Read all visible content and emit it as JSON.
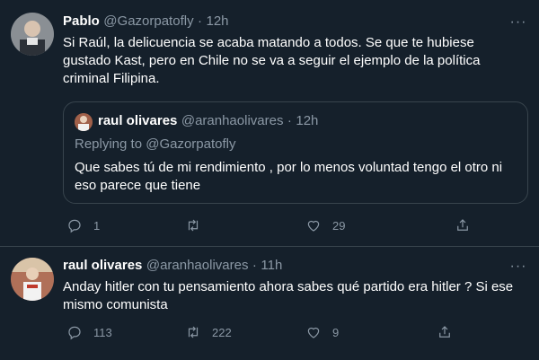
{
  "tweet1": {
    "name": "Pablo",
    "handle": "@Gazorpatofly",
    "separator": "·",
    "time": "12h",
    "text_line1": "Si Raúl, la delicuencia se acaba matando a todos. Se que te hubiese",
    "text_line2": "gustado Kast, pero en Chile no se va a seguir el ejemplo de la política",
    "text_line3": "criminal Filipina.",
    "quote": {
      "name": "raul olivares",
      "handle": "@aranhaolivares",
      "separator": "·",
      "time": "12h",
      "replying_to": "Replying to @Gazorpatofly",
      "text_line1": "Que sabes tú de mi rendimiento , por lo menos voluntad tengo el otro ni",
      "text_line2": "eso parece que tiene"
    },
    "actions": {
      "reply_count": "1",
      "retweet_count": "",
      "like_count": "29"
    }
  },
  "tweet2": {
    "name": "raul olivares",
    "handle": "@aranhaolivares",
    "separator": "·",
    "time": "11h",
    "text_line1": "Anday hitler con tu pensamiento ahora sabes qué partido era hitler ? Si ese",
    "text_line2": "mismo comunista",
    "actions": {
      "reply_count": "113",
      "retweet_count": "222",
      "like_count": "9"
    }
  },
  "colors": {
    "background": "#15202b",
    "border": "#38444d",
    "muted": "#8b98a5",
    "text": "#ffffff"
  }
}
